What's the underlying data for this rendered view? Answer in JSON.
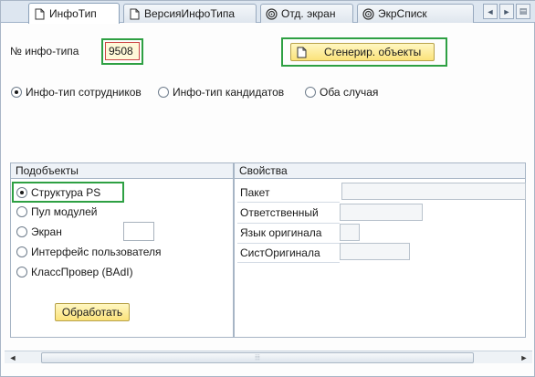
{
  "tabs": [
    {
      "label": "ИнфоТип",
      "icon": "document-icon",
      "active": true
    },
    {
      "label": "ВерсияИнфоТипа",
      "icon": "document-icon",
      "active": false
    },
    {
      "label": "Отд. экран",
      "icon": "spiral-icon",
      "active": false
    },
    {
      "label": "ЭкрСписк",
      "icon": "spiral-icon",
      "active": false
    }
  ],
  "tab_nav": {
    "prev": "◄",
    "next": "►",
    "menu": "▤"
  },
  "infotype": {
    "label": "№ инфо-типа",
    "value": "9508"
  },
  "generate_button": {
    "label": "Сгенерир. объекты",
    "icon": "document-icon"
  },
  "scope_radios": [
    {
      "label": "Инфо-тип сотрудников",
      "selected": true
    },
    {
      "label": "Инфо-тип кандидатов",
      "selected": false
    },
    {
      "label": "Оба случая",
      "selected": false
    }
  ],
  "subobjects": {
    "title": "Подобъекты",
    "options": [
      {
        "label": "Структура PS",
        "selected": true
      },
      {
        "label": "Пул модулей",
        "selected": false
      },
      {
        "label": "Экран",
        "selected": false
      },
      {
        "label": "Интерфейс пользователя",
        "selected": false
      },
      {
        "label": "КлассПровер (BAdI)",
        "selected": false
      }
    ],
    "process_button": "Обработать"
  },
  "properties": {
    "title": "Свойства",
    "fields": [
      {
        "label": "Пакет",
        "value": ""
      },
      {
        "label": "Ответственный",
        "value": ""
      },
      {
        "label": "Язык оригинала",
        "value": ""
      },
      {
        "label": "СистОригинала",
        "value": ""
      }
    ]
  },
  "scrollbar": {
    "left": "◄",
    "right": "►",
    "grip": "⦙⦙⦙"
  },
  "colors": {
    "highlight_border": "#2ea043",
    "tab_bar": "#dde6f0",
    "button_yellow": "#fbe27a"
  }
}
